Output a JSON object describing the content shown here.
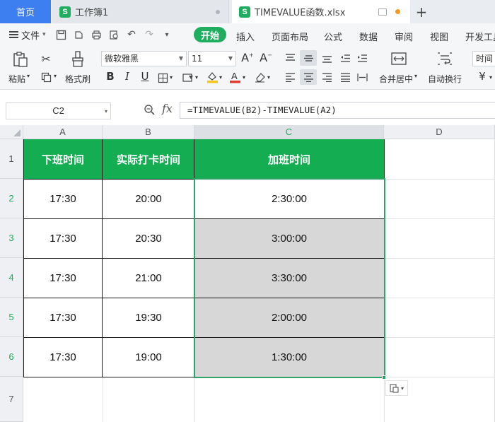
{
  "tabs": {
    "home": "首页",
    "workbook1": "工作簿1",
    "file": "TIMEVALUE函数.xlsx",
    "add": "+"
  },
  "menu": {
    "file": "文件",
    "start": "开始",
    "items": [
      "插入",
      "页面布局",
      "公式",
      "数据",
      "审阅",
      "视图",
      "开发工具"
    ]
  },
  "ribbon": {
    "paste": "粘贴",
    "format_painter": "格式刷",
    "font": "微软雅黑",
    "font_size": "11",
    "merge_center": "合并居中",
    "wrap_text": "自动换行",
    "number_format": "时间",
    "currency": "¥"
  },
  "formula_bar": {
    "name_box": "C2",
    "fx": "fx",
    "formula": "=TIMEVALUE(B2)-TIMEVALUE(A2)"
  },
  "sheet": {
    "columns": [
      "A",
      "B",
      "C",
      "D"
    ],
    "rows": [
      "1",
      "2",
      "3",
      "4",
      "5",
      "6",
      "7"
    ],
    "headers": [
      "下班时间",
      "实际打卡时间",
      "加班时间"
    ],
    "data": [
      [
        "17:30",
        "20:00",
        "2:30:00"
      ],
      [
        "17:30",
        "20:30",
        "3:00:00"
      ],
      [
        "17:30",
        "21:00",
        "3:30:00"
      ],
      [
        "17:30",
        "19:30",
        "2:00:00"
      ],
      [
        "17:30",
        "19:00",
        "1:30:00"
      ]
    ]
  },
  "colors": {
    "accent_green": "#14ad52",
    "home_tab_blue": "#3d7ef0",
    "selection_gray": "#d7d7d7"
  }
}
